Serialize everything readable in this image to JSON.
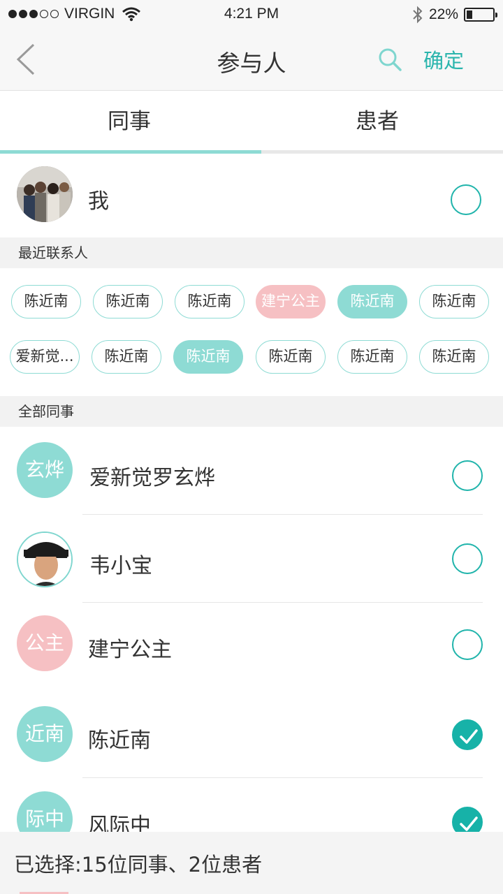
{
  "status_bar": {
    "carrier": "VIRGIN",
    "time": "4:21 PM",
    "battery": "22%",
    "battery_level": 0.22
  },
  "nav": {
    "title": "参与人",
    "confirm_label": "确定"
  },
  "tabs": [
    {
      "label": "同事",
      "active": true
    },
    {
      "label": "患者",
      "active": false
    }
  ],
  "self": {
    "name": "我",
    "selected": false
  },
  "recent": {
    "header": "最近联系人",
    "chips": [
      {
        "label": "陈近南",
        "state": "normal"
      },
      {
        "label": "陈近南",
        "state": "normal"
      },
      {
        "label": "陈近南",
        "state": "normal"
      },
      {
        "label": "建宁公主",
        "state": "pink"
      },
      {
        "label": "陈近南",
        "state": "mint"
      },
      {
        "label": "陈近南",
        "state": "normal"
      },
      {
        "label": "爱新觉...",
        "state": "normal"
      },
      {
        "label": "陈近南",
        "state": "normal"
      },
      {
        "label": "陈近南",
        "state": "mint"
      },
      {
        "label": "陈近南",
        "state": "normal"
      },
      {
        "label": "陈近南",
        "state": "normal"
      },
      {
        "label": "陈近南",
        "state": "normal"
      }
    ]
  },
  "colleagues": {
    "header": "全部同事",
    "items": [
      {
        "avatar_text": "玄烨",
        "name": "爱新觉罗玄烨",
        "selected": false
      },
      {
        "avatar_text": "",
        "name": "韦小宝",
        "selected": false
      },
      {
        "avatar_text": "公主",
        "name": "建宁公主",
        "selected": false
      },
      {
        "avatar_text": "近南",
        "name": "陈近南",
        "selected": true
      },
      {
        "avatar_text": "际中",
        "name": "风际中",
        "selected": true
      }
    ]
  },
  "footer": {
    "summary": "已选择:15位同事、2位患者"
  },
  "colors": {
    "accent": "#2bb5ad",
    "mint": "#8edbd4",
    "pink": "#f6c0c3",
    "check_on": "#17b2a8"
  }
}
